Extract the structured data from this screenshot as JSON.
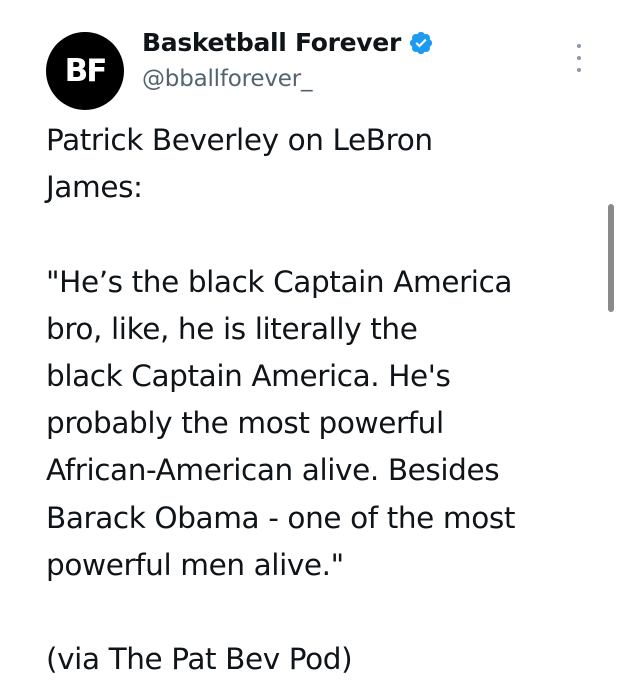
{
  "account": {
    "avatar_text": "BF",
    "display_name": "Basketball Forever",
    "handle": "@bballforever_",
    "verified": true
  },
  "tweet": {
    "line1": "Patrick Beverley on LeBron",
    "line2": "James:",
    "line3": "\"He’s the black Captain America",
    "line4": "bro, like, he is literally the",
    "line5": "black Captain America. He's",
    "line6": "probably the most powerful",
    "line7": "African-American alive. Besides",
    "line8": "Barack Obama - one of the most",
    "line9": "powerful men alive.\"",
    "line10": "(via The Pat Bev Pod)"
  },
  "icons": {
    "verified": "verified-badge-icon",
    "more": "more-options-icon"
  },
  "colors": {
    "text": "#0f1419",
    "secondary": "#536471",
    "verified_blue": "#1d9bf0",
    "avatar_bg": "#000000"
  }
}
